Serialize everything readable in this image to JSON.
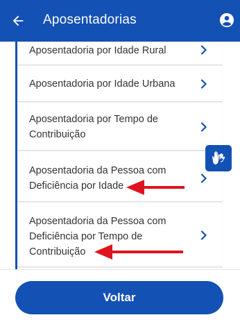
{
  "app_bar": {
    "title": "Aposentadorias",
    "back_icon": "arrow-left-icon",
    "account_icon": "account-circle-icon",
    "background_color": "#1351b4"
  },
  "list": {
    "items": [
      {
        "label": "Aposentadoria por Idade Rural"
      },
      {
        "label": "Aposentadoria por Idade Urbana"
      },
      {
        "label": "Aposentadoria por Tempo de Contribuição"
      },
      {
        "label": "Aposentadoria da Pessoa com Deficiência por Idade"
      },
      {
        "label": "Aposentadoria da Pessoa com Deficiência por Tempo de Contribuição"
      }
    ],
    "chevron_icon": "chevron-right-icon",
    "accent_color": "#1351b4"
  },
  "annotations": {
    "arrow_color": "#e0141e",
    "arrow_icon": "red-arrow-left-icon"
  },
  "accessibility_widget": {
    "icon": "hand-sign-language-icon"
  },
  "footer": {
    "voltar_label": "Voltar"
  }
}
